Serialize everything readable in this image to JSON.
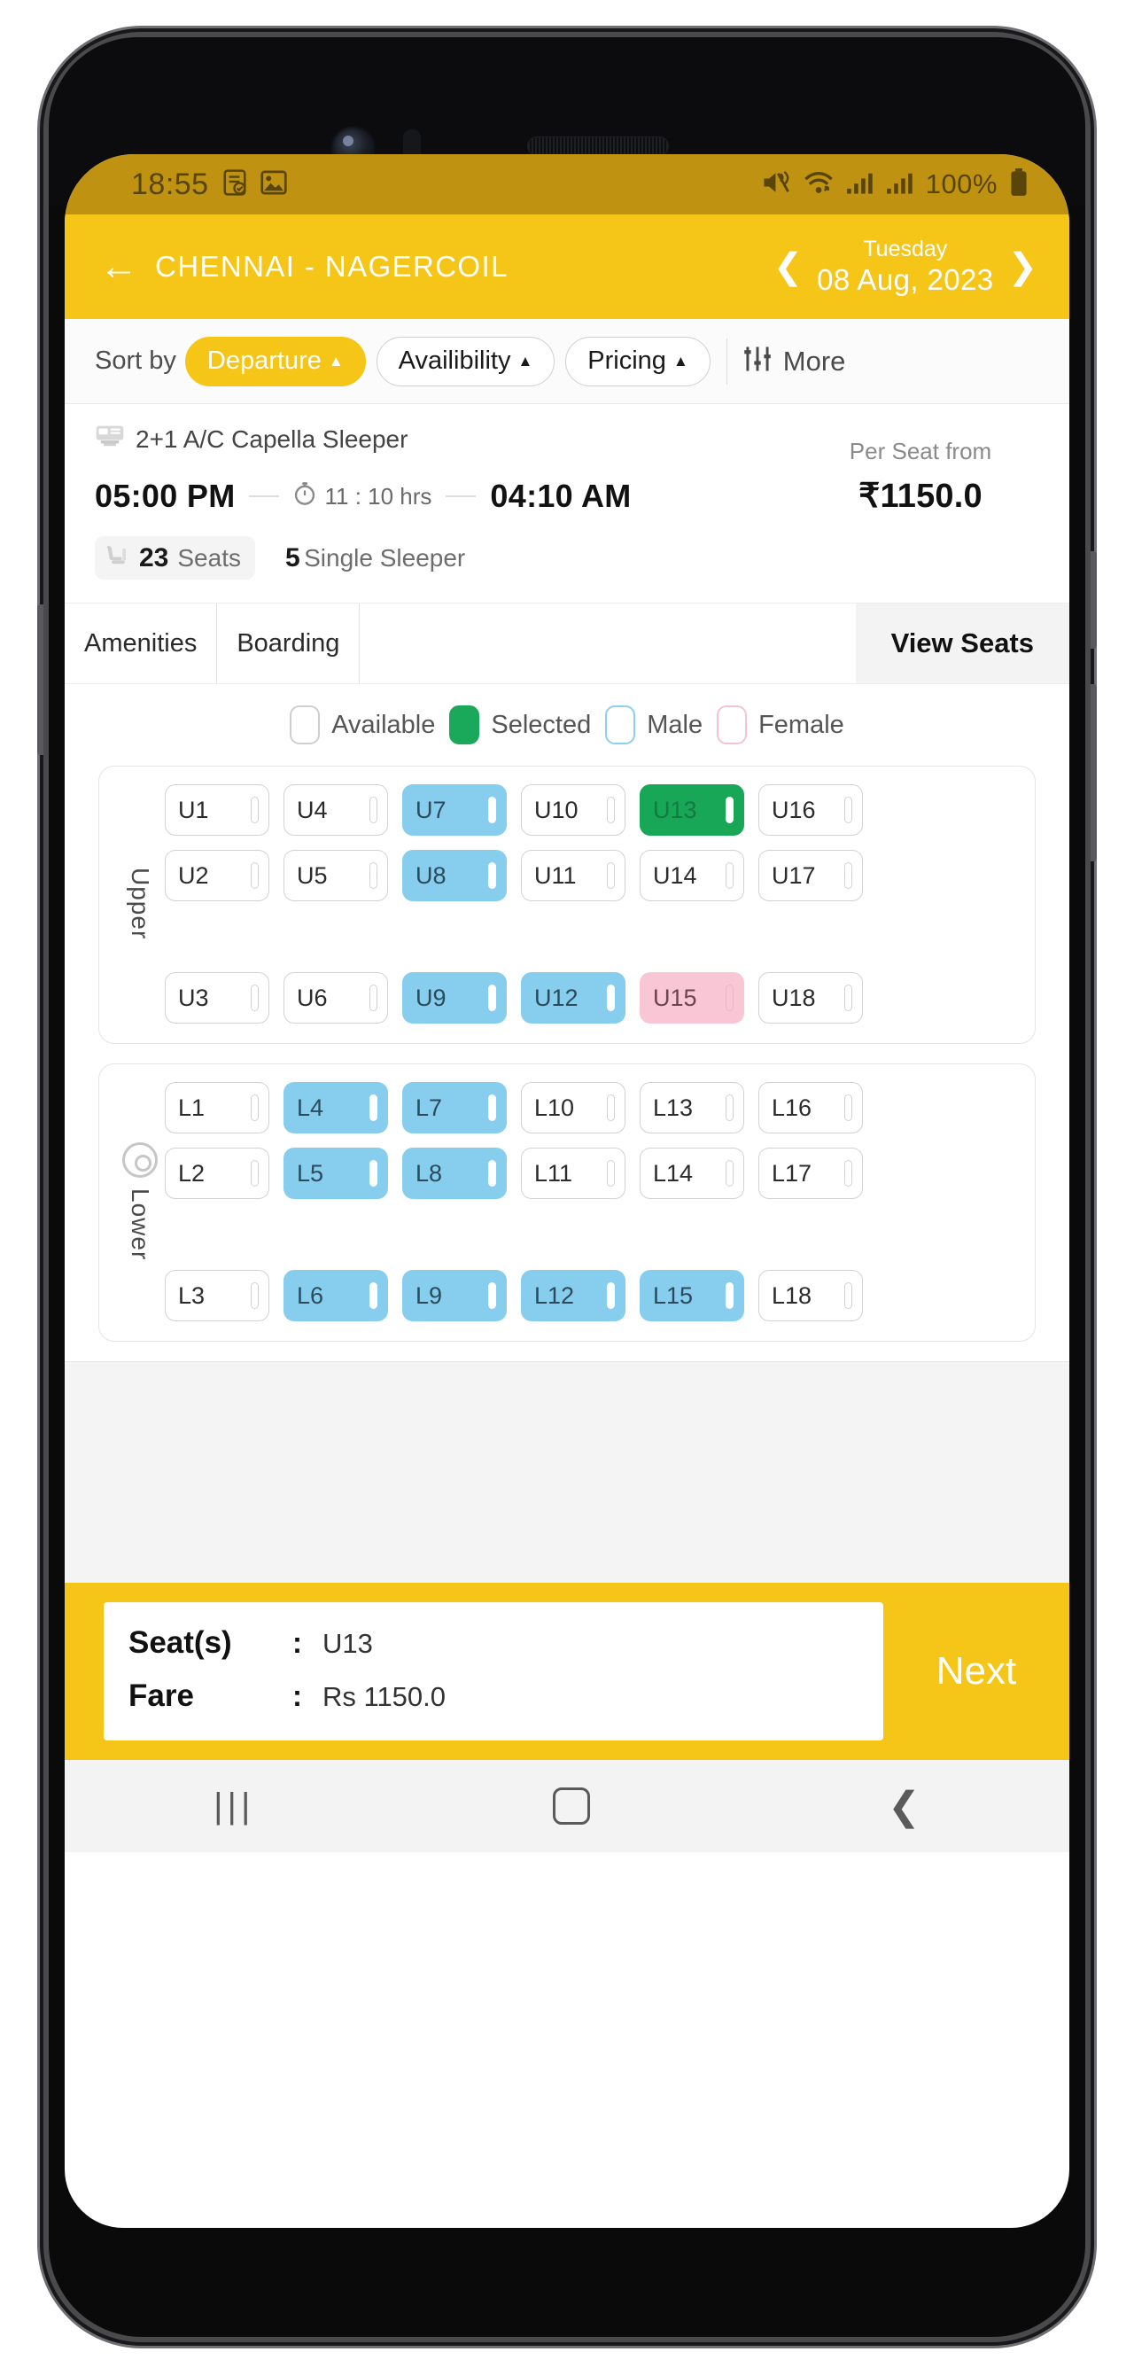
{
  "status_bar": {
    "time": "18:55",
    "left_icons": [
      "task-icon",
      "image-icon"
    ],
    "right_icons": [
      "mute-icon",
      "wifi-icon",
      "signal-icon",
      "signal-icon"
    ],
    "battery_text": "100%",
    "battery_icon": "battery-full-icon"
  },
  "app_bar": {
    "back_icon": "back-arrow-icon",
    "route": "CHENNAI - NAGERCOIL",
    "prev_icon": "chevron-left-icon",
    "next_icon": "chevron-right-icon",
    "day": "Tuesday",
    "date": "08 Aug, 2023"
  },
  "sort_bar": {
    "label": "Sort by",
    "pills": [
      {
        "label": "Departure",
        "active": true
      },
      {
        "label": "Availibility",
        "active": false
      },
      {
        "label": "Pricing",
        "active": false
      }
    ],
    "filter_icon": "filter-icon",
    "more_label": "More"
  },
  "bus": {
    "bus_icon": "bus-icon",
    "type": "2+1 A/C Capella Sleeper",
    "departure": "05:00 PM",
    "duration_icon": "clock-icon",
    "duration": "11 : 10 hrs",
    "arrival": "04:10 AM",
    "seat_icon": "seat-icon",
    "seats_count": "23",
    "seats_label": "Seats",
    "single_count": "5",
    "single_label": "Single Sleeper",
    "price_label": "Per Seat from",
    "price_value": "₹1150.0"
  },
  "tabs": [
    {
      "label": "Amenities",
      "active": false
    },
    {
      "label": "Boarding",
      "active": false
    }
  ],
  "view_seats_tab": "View Seats",
  "legend": [
    {
      "label": "Available",
      "state": "available"
    },
    {
      "label": "Selected",
      "state": "selected"
    },
    {
      "label": "Male",
      "state": "male"
    },
    {
      "label": "Female",
      "state": "female"
    }
  ],
  "decks": [
    {
      "name": "Upper",
      "has_wheel": false,
      "rows": [
        [
          {
            "id": "U1",
            "state": "available"
          },
          {
            "id": "U4",
            "state": "available"
          },
          {
            "id": "U7",
            "state": "male"
          },
          {
            "id": "U10",
            "state": "available"
          },
          {
            "id": "U13",
            "state": "selected"
          },
          {
            "id": "U16",
            "state": "available"
          }
        ],
        [
          {
            "id": "U2",
            "state": "available"
          },
          {
            "id": "U5",
            "state": "available"
          },
          {
            "id": "U8",
            "state": "male"
          },
          {
            "id": "U11",
            "state": "available"
          },
          {
            "id": "U14",
            "state": "available"
          },
          {
            "id": "U17",
            "state": "available"
          }
        ],
        [
          {
            "id": "U3",
            "state": "available"
          },
          {
            "id": "U6",
            "state": "available"
          },
          {
            "id": "U9",
            "state": "male"
          },
          {
            "id": "U12",
            "state": "male"
          },
          {
            "id": "U15",
            "state": "female"
          },
          {
            "id": "U18",
            "state": "available"
          }
        ]
      ]
    },
    {
      "name": "Lower",
      "has_wheel": true,
      "rows": [
        [
          {
            "id": "L1",
            "state": "available"
          },
          {
            "id": "L4",
            "state": "male"
          },
          {
            "id": "L7",
            "state": "male"
          },
          {
            "id": "L10",
            "state": "available"
          },
          {
            "id": "L13",
            "state": "available"
          },
          {
            "id": "L16",
            "state": "available"
          }
        ],
        [
          {
            "id": "L2",
            "state": "available"
          },
          {
            "id": "L5",
            "state": "male"
          },
          {
            "id": "L8",
            "state": "male"
          },
          {
            "id": "L11",
            "state": "available"
          },
          {
            "id": "L14",
            "state": "available"
          },
          {
            "id": "L17",
            "state": "available"
          }
        ],
        [
          {
            "id": "L3",
            "state": "available"
          },
          {
            "id": "L6",
            "state": "male"
          },
          {
            "id": "L9",
            "state": "male"
          },
          {
            "id": "L12",
            "state": "male"
          },
          {
            "id": "L15",
            "state": "male"
          },
          {
            "id": "L18",
            "state": "available"
          }
        ]
      ]
    }
  ],
  "bottom": {
    "seats_key": "Seat(s)",
    "seats_sep": ":",
    "seats_value": "U13",
    "fare_key": "Fare",
    "fare_sep": ":",
    "fare_value": "Rs 1150.0",
    "next_label": "Next"
  },
  "nav_bar": {
    "recent_icon": "recents-icon",
    "home_icon": "home-icon",
    "back_icon": "nav-back-icon"
  },
  "colors": {
    "brand_yellow": "#f5c518",
    "status_yellow": "#bf9311",
    "selected_green": "#18a657",
    "male_blue": "#87cdee",
    "female_pink": "#f9c6d6"
  }
}
